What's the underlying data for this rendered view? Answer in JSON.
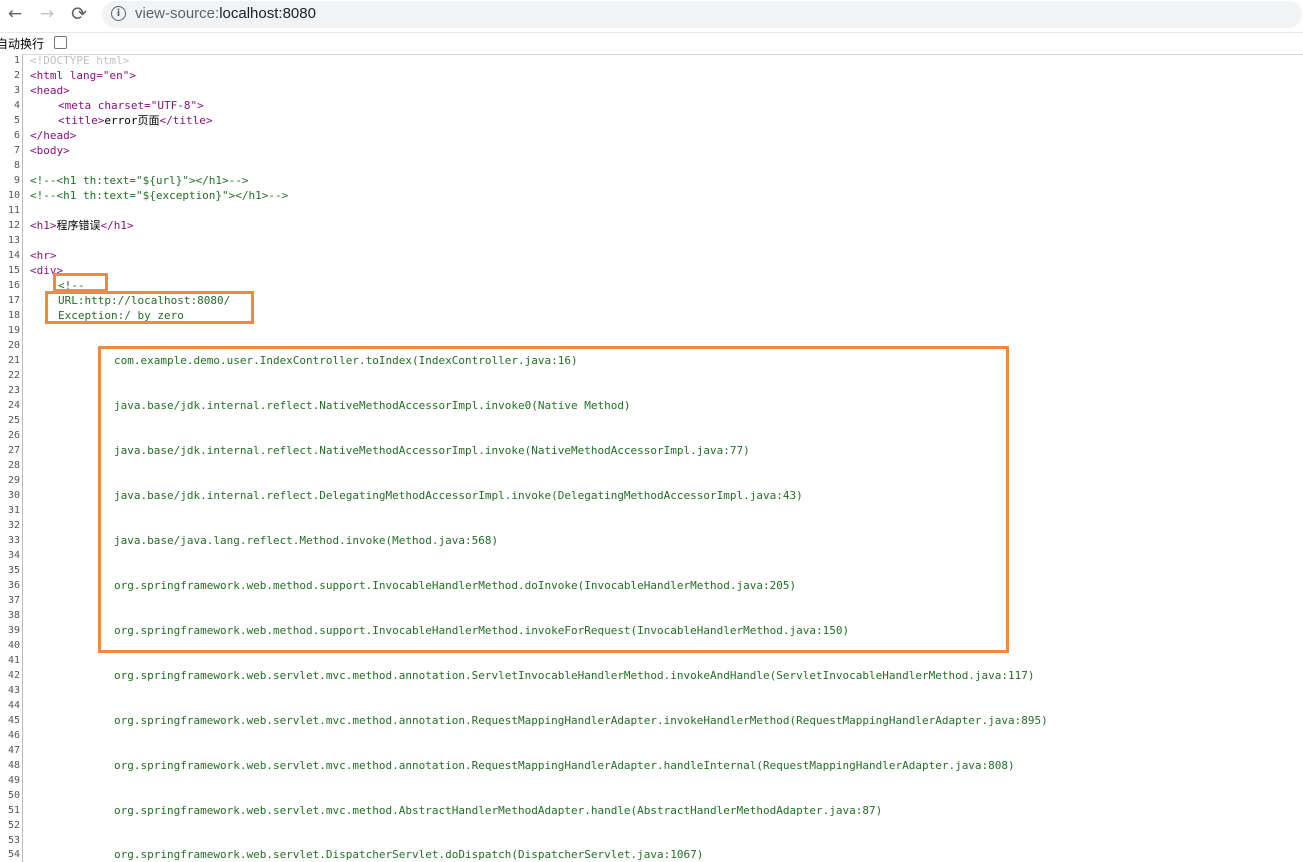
{
  "browser": {
    "back_icon": "←",
    "forward_icon": "→",
    "reload_icon": "⟳",
    "info_icon": "i",
    "url_scheme": "view-source:",
    "url_host": "localhost:8080"
  },
  "wrap": {
    "label": "自动换行",
    "checked": false
  },
  "source": {
    "doctype": "<!DOCTYPE html>",
    "html_open": "<html lang=\"en\">",
    "head_open": "<head>",
    "meta_tag": "<meta charset=\"UTF-8\">",
    "title_open": "<title>",
    "title_text": "error页面",
    "title_close": "</title>",
    "head_close": "</head>",
    "body_open": "<body>",
    "comment_url": "<!--<h1 th:text=\"${url}\"></h1>-->",
    "comment_exception": "<!--<h1 th:text=\"${exception}\"></h1>-->",
    "h1_open": "<h1>",
    "h1_text": "程序错误",
    "h1_close": "</h1>",
    "hr": "<hr>",
    "div_open": "<div>",
    "comment_start": "<!--",
    "url_line": "URL:http://localhost:8080/",
    "exception_line": "Exception:/ by zero",
    "stack": [
      "com.example.demo.user.IndexController.toIndex(IndexController.java:16)",
      "java.base/jdk.internal.reflect.NativeMethodAccessorImpl.invoke0(Native Method)",
      "java.base/jdk.internal.reflect.NativeMethodAccessorImpl.invoke(NativeMethodAccessorImpl.java:77)",
      "java.base/jdk.internal.reflect.DelegatingMethodAccessorImpl.invoke(DelegatingMethodAccessorImpl.java:43)",
      "java.base/java.lang.reflect.Method.invoke(Method.java:568)",
      "org.springframework.web.method.support.InvocableHandlerMethod.doInvoke(InvocableHandlerMethod.java:205)",
      "org.springframework.web.method.support.InvocableHandlerMethod.invokeForRequest(InvocableHandlerMethod.java:150)",
      "org.springframework.web.servlet.mvc.method.annotation.ServletInvocableHandlerMethod.invokeAndHandle(ServletInvocableHandlerMethod.java:117)",
      "org.springframework.web.servlet.mvc.method.annotation.RequestMappingHandlerAdapter.invokeHandlerMethod(RequestMappingHandlerAdapter.java:895)",
      "org.springframework.web.servlet.mvc.method.annotation.RequestMappingHandlerAdapter.handleInternal(RequestMappingHandlerAdapter.java:808)",
      "org.springframework.web.servlet.mvc.method.AbstractHandlerMethodAdapter.handle(AbstractHandlerMethodAdapter.java:87)",
      "org.springframework.web.servlet.DispatcherServlet.doDispatch(DispatcherServlet.java:1067)"
    ]
  },
  "line_numbers": [
    "1",
    "2",
    "3",
    "4",
    "5",
    "6",
    "7",
    "8",
    "9",
    "10",
    "11",
    "12",
    "13",
    "14",
    "15",
    "16",
    "17",
    "18",
    "19",
    "20",
    "21",
    "22",
    "23",
    "24",
    "25",
    "26",
    "27",
    "28",
    "29",
    "30",
    "31",
    "32",
    "33",
    "34",
    "35",
    "36",
    "37",
    "38",
    "39",
    "40",
    "41",
    "42",
    "43",
    "44",
    "45",
    "46",
    "47",
    "48",
    "49",
    "50",
    "51",
    "52",
    "53",
    "54"
  ],
  "colors": {
    "highlight": "#f0883e",
    "tag": "#881280",
    "comment": "#236e25"
  }
}
